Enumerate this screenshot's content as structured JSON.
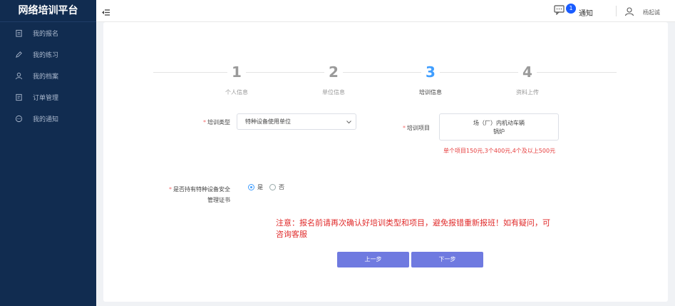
{
  "app": {
    "title": "网络培训平台"
  },
  "sidebar": {
    "items": [
      {
        "label": "我的报名",
        "icon": "clipboard-icon"
      },
      {
        "label": "我的练习",
        "icon": "pencil-icon"
      },
      {
        "label": "我的档案",
        "icon": "user-outline-icon"
      },
      {
        "label": "订单管理",
        "icon": "document-icon"
      },
      {
        "label": "我的通知",
        "icon": "chat-icon"
      }
    ]
  },
  "header": {
    "notify_count": "1",
    "notify_label": "通知",
    "username": "杨起诚"
  },
  "steps": [
    {
      "num": "1",
      "label": "个人信息"
    },
    {
      "num": "2",
      "label": "单位信息"
    },
    {
      "num": "3",
      "label": "培训信息"
    },
    {
      "num": "4",
      "label": "资料上传"
    }
  ],
  "active_step": 3,
  "form": {
    "type_label": "培训类型",
    "type_value": "特种设备使用单位",
    "project_label": "培训项目",
    "project_line1": "场（厂）内机动车辆",
    "project_line2": "锅炉",
    "price_note": "单个项目150元,3个400元,4个及以上500元",
    "cert_label_line1": "是否持有特种设备安全",
    "cert_label_line2": "管理证书",
    "cert_yes": "是",
    "cert_no": "否",
    "cert_selected": "是"
  },
  "notice": "注意：报名前请再次确认好培训类型和项目，避免报错重新报班！如有疑问，可咨询客服",
  "buttons": {
    "prev": "上一步",
    "next": "下一步"
  },
  "colors": {
    "sidebar_bg": "#112c50",
    "accent": "#409eff",
    "button": "#6f7ae0",
    "warning": "#e02a2a"
  }
}
